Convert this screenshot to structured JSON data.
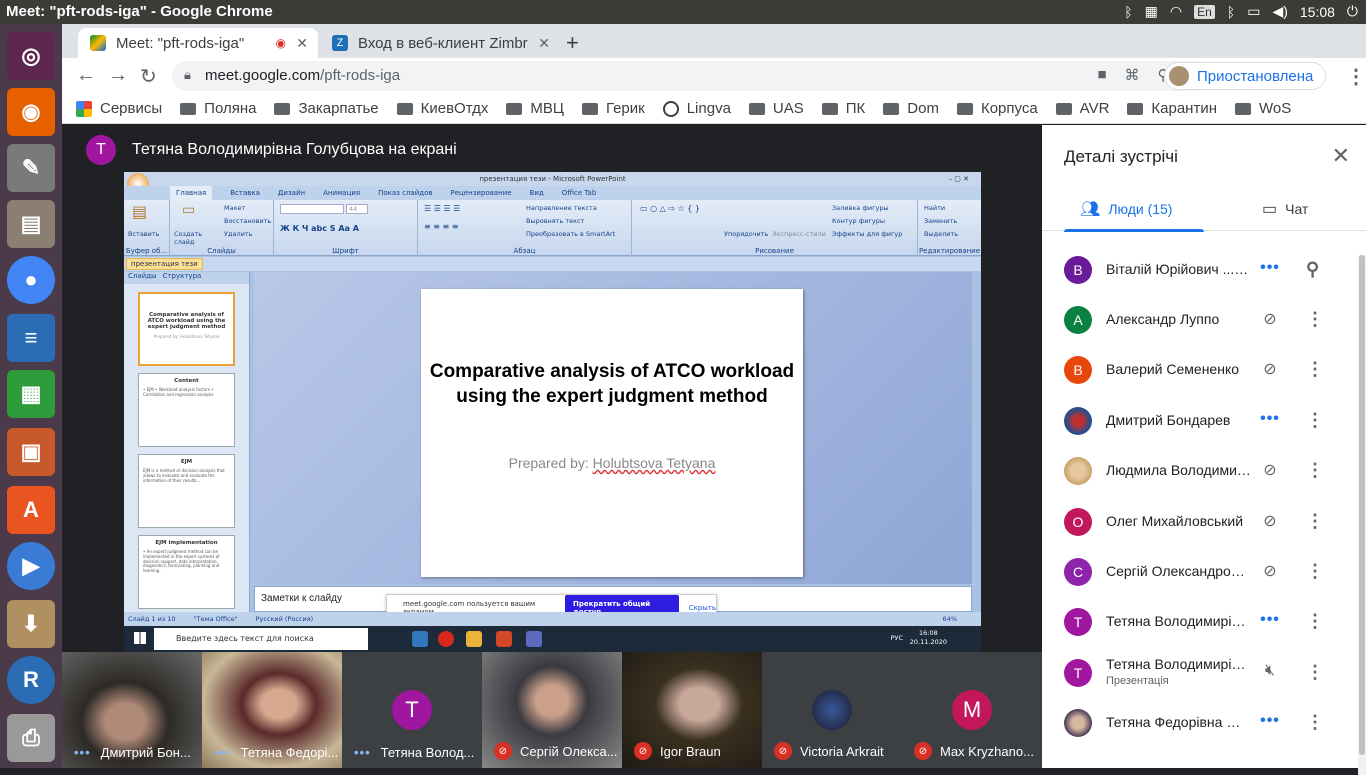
{
  "os": {
    "window_title": "Meet: \"pft-rods-iga\" - Google Chrome",
    "lang": "En",
    "time": "15:08"
  },
  "chrome": {
    "tabs": [
      {
        "label": "Meet: \"pft-rods-iga\""
      },
      {
        "label": "Вход в веб-клиент Zimbr"
      }
    ],
    "url_host": "meet.google.com",
    "url_path": "/pft-rods-iga",
    "profile_label": "Приостановлена",
    "bookmarks": [
      "Сервисы",
      "Поляна",
      "Закарпатье",
      "КиевОтдх",
      "МВЦ",
      "Герик",
      "Lingva",
      "UAS",
      "ПК",
      "Dom",
      "Корпуса",
      "AVR",
      "Карантин",
      "WoS"
    ]
  },
  "meet": {
    "presenter_initial": "T",
    "presenter_text": "Тетяна Володимирівна Голубцова на екрані",
    "screen": {
      "pp_title": "презентация тези - Microsoft PowerPoint",
      "menu": [
        "Главная",
        "Вставка",
        "Дизайн",
        "Анимация",
        "Показ слайдов",
        "Рецензирование",
        "Вид",
        "Office Tab"
      ],
      "ribbon_groups": [
        "Буфер об...",
        "Слайды",
        "Шрифт",
        "Абзац",
        "Рисование",
        "Редактирование"
      ],
      "ribbon_items": {
        "paste": "Вставить",
        "create": "Создать слайд",
        "layout": "Макет",
        "reset": "Восстановить",
        "delete": "Удалить",
        "font_size": "44",
        "text_dir": "Направление текста",
        "align_text": "Выровнять текст",
        "smartart": "Преобразовать в SmartArt",
        "arrange": "Упорядочить",
        "quick_styles": "Экспресс-стили",
        "fill": "Заливка фигуры",
        "outline": "Контур фигуры",
        "effects": "Эффекты для фигур",
        "find": "Найти",
        "replace": "Заменить",
        "select": "Выделить"
      },
      "doc_tab": "презентация тези",
      "panel_tabs": [
        "Слайды",
        "Структура"
      ],
      "thumbs": [
        {
          "num": "1",
          "title": "Comparative analysis of ATCO workload using the expert judgment method",
          "body": "Prepared by: Holubtsova Tetyana"
        },
        {
          "num": "2",
          "title": "Content",
          "body": "• EJM • Workload analysis factors • Correlation and regression analysis"
        },
        {
          "num": "3",
          "title": "EJM",
          "body": "EJM is a method of decision analysis that allows to evaluate and evaluate the information of their results..."
        },
        {
          "num": "4",
          "title": "EJM implementation",
          "body": "• An expert judgment method can be implemented in the expert systems of decision support, data interpretation, diagnostics, forecasting, planning and learning."
        }
      ],
      "slide_title": "Comparative analysis of ATCO workload using the expert judgment method",
      "slide_prepared_label": "Prepared by: ",
      "slide_prepared_name": "Holubtsova Tetyana",
      "notes": "Заметки к слайду",
      "share_msg": "meet.google.com пользуется вашим экраном.",
      "share_stop": "Прекратить общий доступ",
      "share_hide": "Скрыть",
      "status": [
        "Слайд 1 из 10",
        "\"Тема Office\"",
        "Русский (Россия)"
      ],
      "zoom": "64%",
      "win_search": "Введите здесь текст для поиска",
      "win_lang": "РУС",
      "win_time": "16:08",
      "win_date": "20.11.2020"
    },
    "strip": [
      {
        "name": "Дмитрий Бон...",
        "state": "talking"
      },
      {
        "name": "Тетяна Федорі...",
        "state": "talking"
      },
      {
        "name": "Тетяна Волод...",
        "state": "talking",
        "initial": "T",
        "color": "#a0169e"
      },
      {
        "name": "Сергій Олекса...",
        "state": "muted"
      },
      {
        "name": "Igor Braun",
        "state": "muted"
      },
      {
        "name": "Victoria Arkrait",
        "state": "muted"
      },
      {
        "name": "Max Kryzhano...",
        "state": "muted",
        "initial": "M",
        "color": "#c2185b"
      }
    ]
  },
  "panel": {
    "title": "Деталі зустрічі",
    "tab_people": "Люди (15)",
    "tab_chat": "Чат",
    "participants": [
      {
        "initial": "В",
        "name": "Віталій Юрійович ...",
        "you": "(Ви)",
        "color": "#6a1b9a",
        "state": "talking"
      },
      {
        "initial": "А",
        "name": "Александр Луппо",
        "color": "#0b8043",
        "state": "muted"
      },
      {
        "initial": "В",
        "name": "Валерий Семененко",
        "color": "#e8470c",
        "state": "muted"
      },
      {
        "initial": "",
        "name": "Дмитрий Бондарев",
        "color": "#2c4e8a",
        "state": "talking"
      },
      {
        "initial": "",
        "name": "Людмила Володимирі...",
        "color": "#c9a06a",
        "state": "muted"
      },
      {
        "initial": "О",
        "name": "Олег Михайловський",
        "color": "#c2185b",
        "state": "muted"
      },
      {
        "initial": "С",
        "name": "Сергій Олександрови...",
        "color": "#8e24aa",
        "state": "muted"
      },
      {
        "initial": "Т",
        "name": "Тетяна Володимирівна...",
        "color": "#a0169e",
        "state": "talking"
      },
      {
        "initial": "Т",
        "name": "Тетяна Володимирівна...",
        "sub": "Презентація",
        "color": "#a0169e",
        "state": "sharing"
      },
      {
        "initial": "",
        "name": "Тетяна Федорівна Шме...",
        "color": "#4a3a5a",
        "state": "talking"
      }
    ]
  }
}
